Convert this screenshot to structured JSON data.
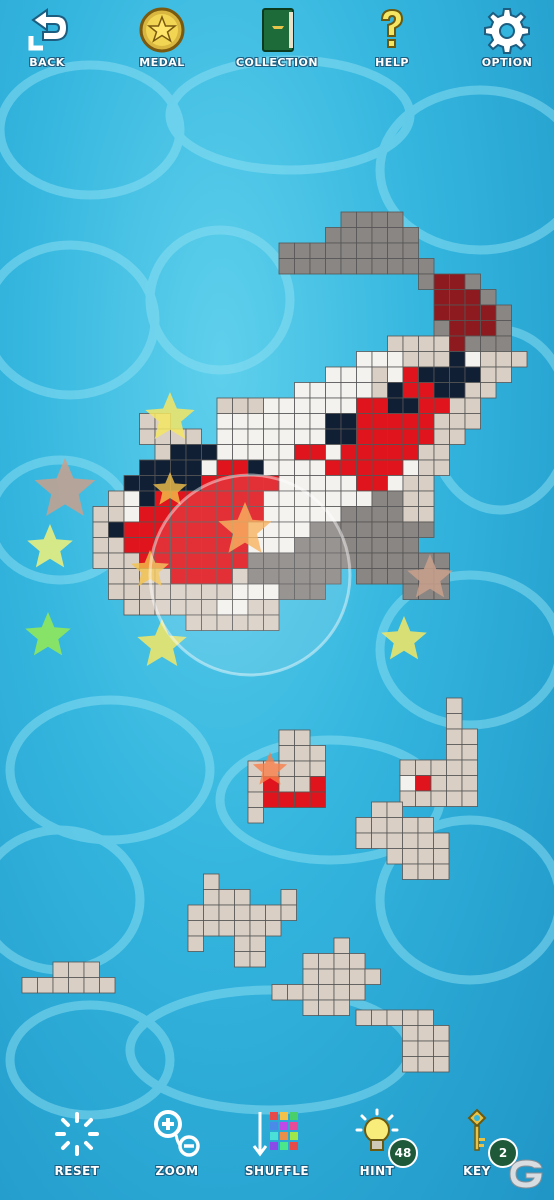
{
  "top_nav": {
    "back": "BACK",
    "medal": "MEDAL",
    "collection": "COLLECTION",
    "help": "HELP",
    "option": "OPTION"
  },
  "bottom_nav": {
    "reset": "RESET",
    "zoom": "ZOOM",
    "shuffle": "SHUFFLE",
    "hint": "HINT",
    "hint_count": "48",
    "key": "KEY",
    "key_count": "2"
  },
  "colors": {
    "grey": "#8a8683",
    "dark_red": "#8c1a1f",
    "red": "#e0141c",
    "navy": "#101f33",
    "white": "#f4f2ee",
    "beige": "#d9cfc5",
    "grid_line": "#555555",
    "accent_yellow": "#f4e663"
  },
  "icons": [
    "back-arrow-icon",
    "medal-star-icon",
    "collection-book-icon",
    "help-question-icon",
    "option-gear-icon",
    "reset-spinner-icon",
    "zoom-icon",
    "shuffle-icon",
    "hint-bulb-icon",
    "key-icon"
  ]
}
